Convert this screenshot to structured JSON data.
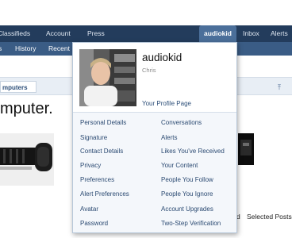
{
  "top_nav": {
    "items": [
      "Classifieds",
      "Account",
      "Press"
    ],
    "active": "audiokid",
    "right_items": [
      "Inbox",
      "Alerts"
    ]
  },
  "sub_nav": {
    "items": [
      "s",
      "History",
      "Recent I"
    ]
  },
  "breadcrumb": {
    "label": "mputers",
    "right_icon": "arrow-up-icon"
  },
  "page_title": "mputer.",
  "dropdown": {
    "username": "audiokid",
    "user_title": "Chris",
    "profile_link": "Your Profile Page",
    "left_links": [
      "Personal Details",
      "Signature",
      "Contact Details",
      "Privacy",
      "Preferences",
      "Alert Preferences",
      "Avatar",
      "Password"
    ],
    "right_links": [
      "Conversations",
      "Alerts",
      "Likes You've Received",
      "Your Content",
      "People You Follow",
      "People You Ignore",
      "Account Upgrades",
      "Two-Step Verification"
    ]
  },
  "bottom": {
    "left_fragment": "d",
    "selected_posts": "Selected Posts:"
  },
  "colors": {
    "top_bar": "#233c5c",
    "sub_bar": "#3a5c85",
    "active_tab": "#4b6f9a",
    "link": "#2b4a72"
  }
}
